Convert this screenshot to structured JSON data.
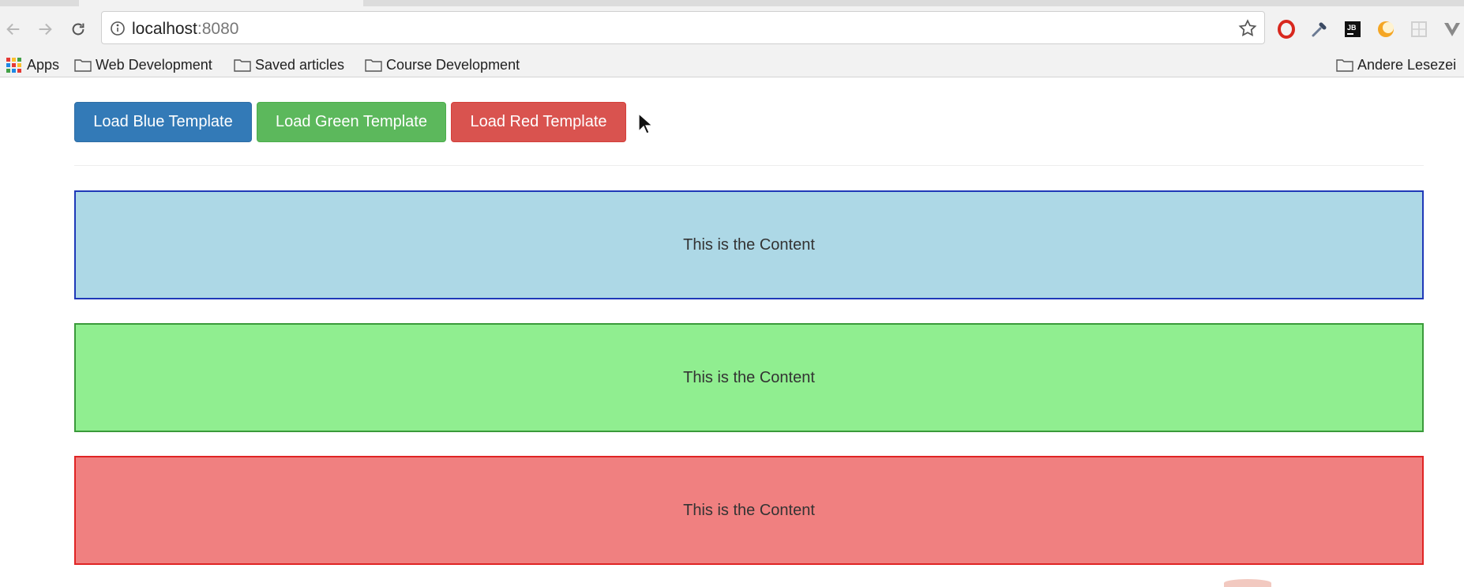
{
  "browser": {
    "address_bar": {
      "host": "localhost",
      "port": ":8080"
    },
    "bookmarks": {
      "apps_label": "Apps",
      "items": [
        {
          "label": "Web Development"
        },
        {
          "label": "Saved articles"
        },
        {
          "label": "Course Development"
        }
      ],
      "other_label": "Andere Lesezei"
    },
    "extensions": [
      {
        "icon": "opera-icon",
        "color": "#d8281e"
      },
      {
        "icon": "eyedropper-icon",
        "color": "#3b4a63"
      },
      {
        "icon": "jb-icon",
        "label": "JB",
        "color": "#111111"
      },
      {
        "icon": "moon-icon",
        "color": "#f5a623"
      },
      {
        "icon": "grid-placeholder-icon",
        "color": "#d0d0d0"
      },
      {
        "icon": "vue-icon",
        "color": "#8a8a8a"
      }
    ]
  },
  "page": {
    "buttons": {
      "blue": "Load Blue Template",
      "green": "Load Green Template",
      "red": "Load Red Template"
    },
    "panels": {
      "blue": "This is the Content",
      "green": "This is the Content",
      "red": "This is the Content"
    },
    "colors": {
      "blue_button": "#337ab7",
      "green_button": "#5cb85c",
      "red_button": "#d9534f",
      "blue_panel": "#add8e6",
      "green_panel": "#90ee90",
      "red_panel": "#f08080"
    }
  }
}
